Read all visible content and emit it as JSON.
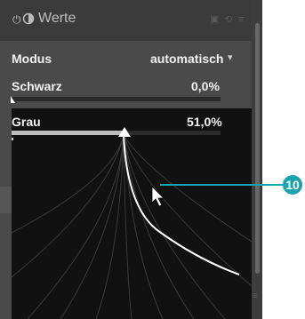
{
  "header": {
    "title": "Werte",
    "power_icon": "power-icon",
    "half_circle_icon": "half-circle-icon",
    "right_icons": [
      "presets-icon",
      "reset-icon",
      "menu-icon"
    ]
  },
  "modus": {
    "label": "Modus",
    "value": "automatisch",
    "dropdown_icon": "chevron-down-icon"
  },
  "schwarz": {
    "label": "Schwarz",
    "value": "0,0%",
    "level": 0.0
  },
  "grau": {
    "label": "Grau",
    "value": "51,0%",
    "level": 0.51
  },
  "callout": {
    "number": "10"
  },
  "colors": {
    "accent": "#19a3ad",
    "panel": "#4a4a4a",
    "curve_bg": "#111111"
  }
}
